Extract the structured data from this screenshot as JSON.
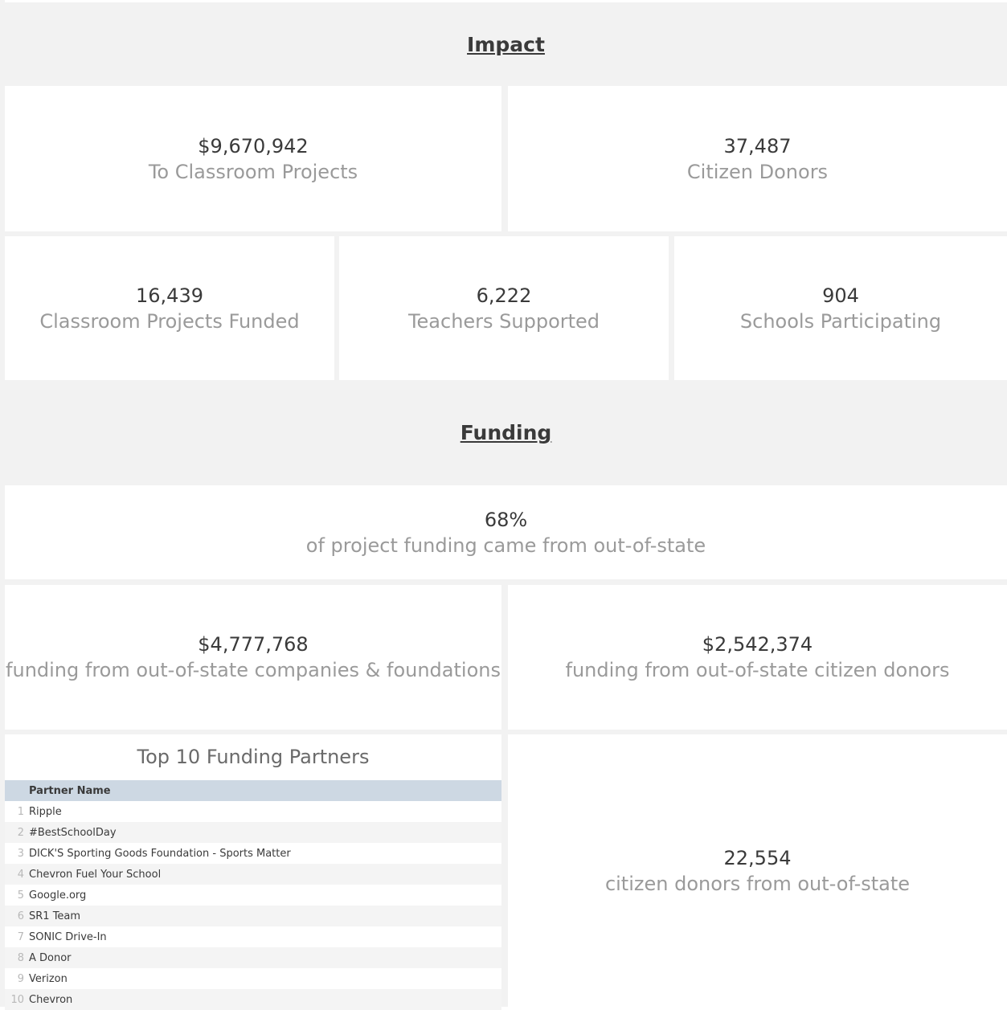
{
  "impact": {
    "title": "Impact",
    "total_funding": {
      "value": "$9,670,942",
      "label": "To Classroom Projects"
    },
    "citizen_donors": {
      "value": "37,487",
      "label": "Citizen Donors"
    },
    "projects_funded": {
      "value": "16,439",
      "label": "Classroom Projects Funded"
    },
    "teachers_supported": {
      "value": "6,222",
      "label": "Teachers Supported"
    },
    "schools_participating": {
      "value": "904",
      "label": "Schools Participating"
    }
  },
  "funding": {
    "title": "Funding",
    "out_of_state_share": {
      "value": "68%",
      "label": "of project funding came from out-of-state"
    },
    "companies_foundations": {
      "value": "$4,777,768",
      "label": "funding from out-of-state companies & foundations"
    },
    "citizen_funding": {
      "value": "$2,542,374",
      "label": "funding from out-of-state citizen donors"
    },
    "citizen_donors_oos": {
      "value": "22,554",
      "label": "citizen donors from out-of-state"
    }
  },
  "partners": {
    "title": "Top 10 Funding Partners",
    "column_header": "Partner Name",
    "rows": [
      {
        "rank": "1",
        "name": "Ripple"
      },
      {
        "rank": "2",
        "name": "#BestSchoolDay"
      },
      {
        "rank": "3",
        "name": "DICK'S Sporting Goods Foundation - Sports Matter"
      },
      {
        "rank": "4",
        "name": "Chevron Fuel Your School"
      },
      {
        "rank": "5",
        "name": "Google.org"
      },
      {
        "rank": "6",
        "name": "SR1 Team"
      },
      {
        "rank": "7",
        "name": "SONIC Drive-In"
      },
      {
        "rank": "8",
        "name": "A Donor"
      },
      {
        "rank": "9",
        "name": "Verizon"
      },
      {
        "rank": "10",
        "name": "Chevron"
      }
    ]
  }
}
